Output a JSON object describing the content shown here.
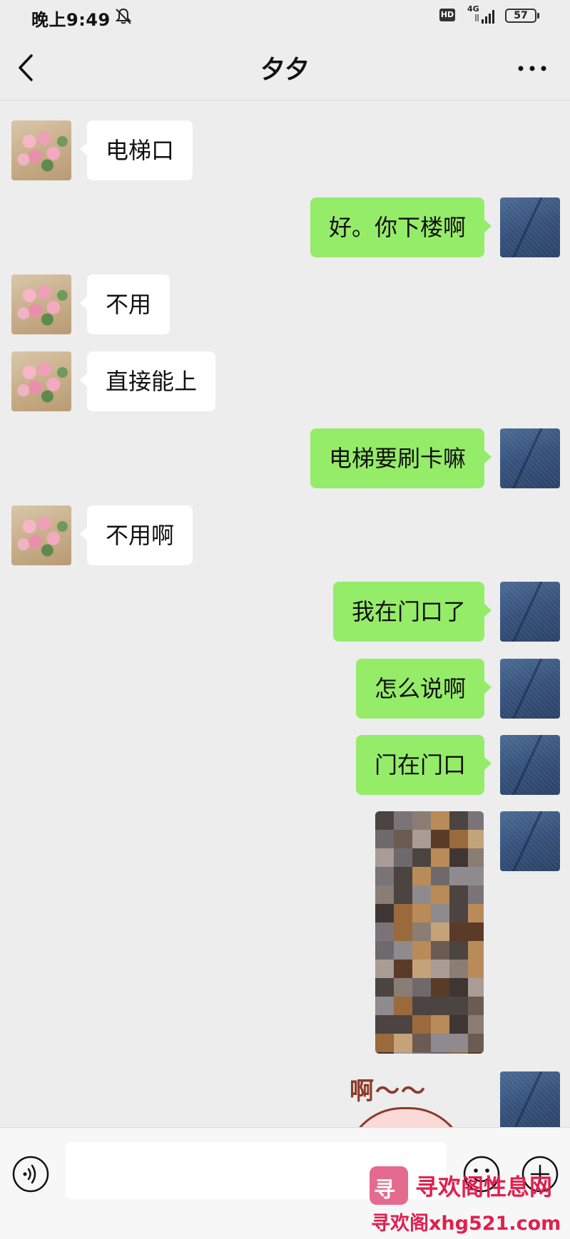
{
  "status_bar": {
    "time": "晚上9:49",
    "hd": "HD",
    "network": "4G",
    "battery": "57"
  },
  "nav": {
    "title": "夕夕"
  },
  "messages": [
    {
      "side": "left",
      "text": "电梯口"
    },
    {
      "side": "right",
      "text": "好。你下楼啊"
    },
    {
      "side": "left",
      "text": "不用"
    },
    {
      "side": "left",
      "text": "直接能上"
    },
    {
      "side": "right",
      "text": "电梯要刷卡嘛"
    },
    {
      "side": "left",
      "text": "不用啊"
    },
    {
      "side": "right",
      "text": "我在门口了"
    },
    {
      "side": "right",
      "text": "怎么说啊"
    },
    {
      "side": "right",
      "text": "门在门口"
    }
  ],
  "sticker": {
    "text": "啊～～"
  },
  "input": {
    "value": ""
  },
  "watermark": {
    "logo_char": "寻",
    "line1": "寻欢阁性息网",
    "line2": "寻欢阁xhg521.com"
  },
  "colors": {
    "background": "#ededed",
    "sent_bubble": "#95ec69",
    "received_bubble": "#ffffff",
    "watermark": "#e0204f"
  }
}
